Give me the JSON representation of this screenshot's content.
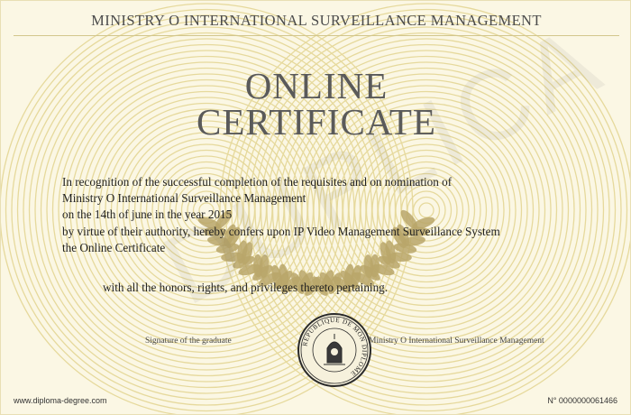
{
  "certificate": {
    "header": "MINISTRY O INTERNATIONAL SURVEILLANCE MANAGEMENT",
    "title_line1": "ONLINE",
    "title_line2": "CERTIFICATE",
    "watermark": "DUPLICA",
    "body_lines": [
      "In recognition of the successful completion of the requisites and on nomination of",
      "Ministry O International Surveillance Management",
      "on the 14th of june in the year 2015",
      "by virtue of their authority, hereby confers upon IP Video Management Surveillance System",
      "the Online Certificate"
    ],
    "honors_line": "with all the honors, rights, and privileges thereto pertaining.",
    "signature_left": "Signature of the graduate",
    "signature_right": "Ministry O International Surveillance Management",
    "seal_text": "REPUBLIQUE DE MON DIPLOME",
    "footer_left": "www.diploma-degree.com",
    "footer_right": "N° 0000000061466"
  },
  "colors": {
    "background": "#fbf7e4",
    "guilloche": "#e6d99c",
    "laurel": "#b9a66a",
    "text": "#1f1f1f",
    "title": "#5a5a5a"
  }
}
